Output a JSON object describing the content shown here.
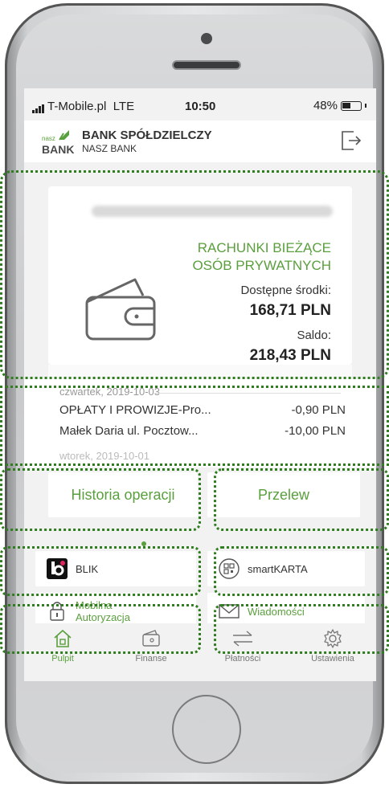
{
  "status_bar": {
    "carrier": "T-Mobile.pl",
    "network": "LTE",
    "time": "10:50",
    "battery": "48%"
  },
  "header": {
    "logo_small": "nasz",
    "logo_big": "BANK",
    "bank_name": "BANK SPÓŁDZIELCZY",
    "bank_sub": "NASZ BANK",
    "logout_icon": "logout-icon"
  },
  "account": {
    "title_line1": "RACHUNKI BIEŻĄCE",
    "title_line2": "OSÓB PRYWATNYCH",
    "available_label": "Dostępne środki:",
    "available_value": "168,71 PLN",
    "saldo_label": "Saldo:",
    "saldo_value": "218,43 PLN",
    "icon": "wallet-icon"
  },
  "transactions": {
    "date1": "czwartek, 2019-10-03",
    "rows": [
      {
        "desc": "OPŁATY I PROWIZJE-Pro...",
        "amount": "-0,90 PLN"
      },
      {
        "desc": "Małek Daria  ul. Pocztow...",
        "amount": "-10,00 PLN"
      }
    ],
    "date2": "wtorek, 2019-10-01"
  },
  "actions": {
    "history": "Historia operacji",
    "transfer": "Przelew",
    "blik": "BLIK",
    "smartkarta": "smartKARTA",
    "mobile_auth_line1": "Mobilna",
    "mobile_auth_line2": "Autoryzacja",
    "messages": "Wiadomości"
  },
  "nav": {
    "items": [
      {
        "label": "Pulpit",
        "icon": "home-icon",
        "active": true
      },
      {
        "label": "Finanse",
        "icon": "wallet-icon",
        "active": false
      },
      {
        "label": "Płatności",
        "icon": "transfer-arrows-icon",
        "active": false
      },
      {
        "label": "Ustawienia",
        "icon": "gear-icon",
        "active": false
      }
    ]
  },
  "colors": {
    "brand_green": "#5a9f3d",
    "highlight_dotted": "#2f7d1e"
  }
}
